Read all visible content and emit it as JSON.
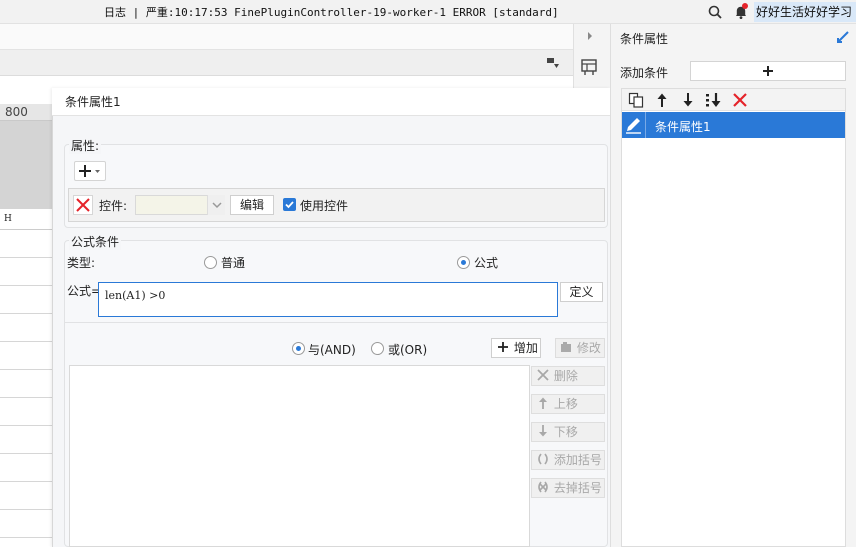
{
  "topbar": {
    "log": "日志 | 严重:10:17:53 FinePluginController-19-worker-1 ERROR [standard]",
    "user_name": "好好生活好好学习"
  },
  "sheet": {
    "ruler_label": "800",
    "column_label": "H"
  },
  "dialog": {
    "title": "条件属性1",
    "property_group": {
      "label": "属性:",
      "control_label": "控件:",
      "edit_button": "编辑",
      "use_control_label": "使用控件",
      "use_control_checked": true
    },
    "formula_group": {
      "label": "公式条件",
      "type_label": "类型:",
      "type_options": [
        "普通",
        "公式"
      ],
      "type_selected": "公式",
      "formula_label": "公式=",
      "formula_value": "len(A1) >0",
      "define_button": "定义",
      "logic_options": [
        "与(AND)",
        "或(OR)"
      ],
      "logic_selected": "与(AND)",
      "add_button": "增加",
      "modify_button": "修改",
      "side_buttons": [
        "删除",
        "上移",
        "下移",
        "添加括号",
        "去掉括号"
      ]
    }
  },
  "right_panel": {
    "title": "条件属性",
    "add_condition_label": "添加条件",
    "items": [
      {
        "label": "条件属性1",
        "selected": true
      }
    ]
  },
  "colors": {
    "accent": "#2a79d7",
    "delete_red": "#e5232a",
    "user_highlight": "#d9e8f8"
  }
}
